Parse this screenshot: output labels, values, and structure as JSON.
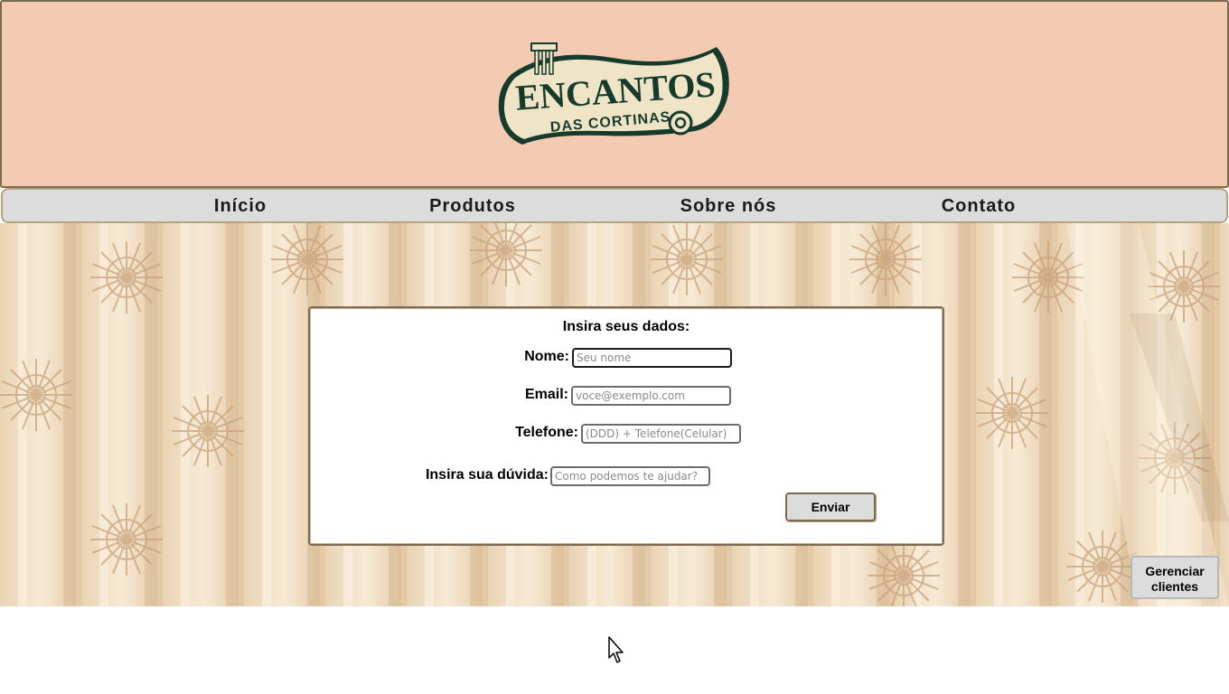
{
  "brand": {
    "logo_top": "ENCANTOS",
    "logo_bottom": "DAS CORTINAS",
    "colors": {
      "header_bg": "#f3cbb2",
      "logo_dark": "#163a2c",
      "logo_cream": "#efe4c5"
    }
  },
  "nav": {
    "items": [
      {
        "label": "Início"
      },
      {
        "label": "Produtos"
      },
      {
        "label": "Sobre nós"
      },
      {
        "label": "Contato"
      }
    ]
  },
  "form": {
    "title": "Insira seus dados:",
    "fields": {
      "name": {
        "label": "Nome:",
        "placeholder": "Seu nome",
        "value": ""
      },
      "email": {
        "label": "Email:",
        "placeholder": "voce@exemplo.com",
        "value": ""
      },
      "phone": {
        "label": "Telefone:",
        "placeholder": "(DDD) + Telefone(Celular)",
        "value": ""
      },
      "question": {
        "label": "Insira sua dúvida:",
        "placeholder": "Como podemos te ajudar?",
        "value": ""
      }
    },
    "submit_label": "Enviar"
  },
  "manage_button": {
    "line1": "Gerenciar",
    "line2": "clientes"
  },
  "icons": {
    "cursor": "mouse-pointer-icon"
  }
}
